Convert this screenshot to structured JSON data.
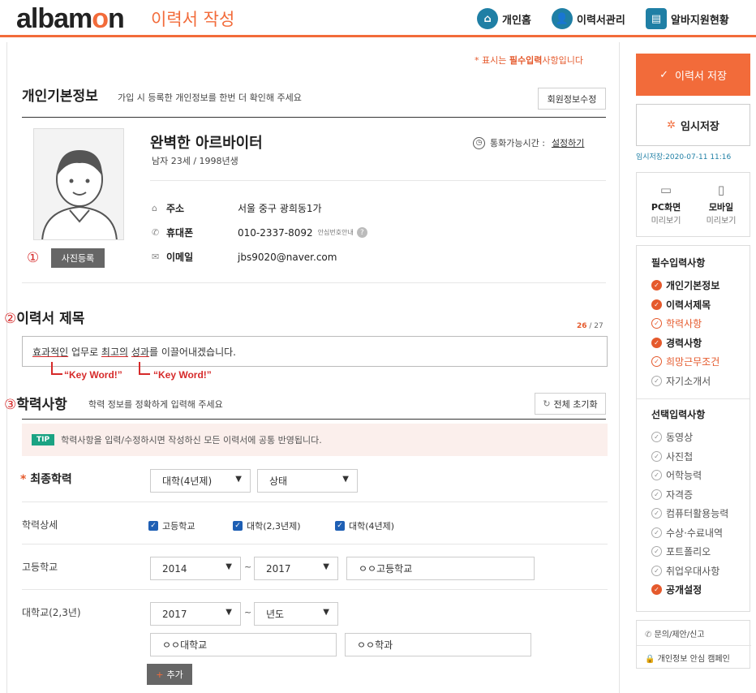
{
  "header": {
    "logo": {
      "a": "albam",
      "o": "o",
      "n": "n"
    },
    "page_title": "이력서 작성",
    "nav": [
      {
        "label": "개인홈",
        "icon": "home-icon"
      },
      {
        "label": "이력서관리",
        "icon": "user-add-icon"
      },
      {
        "label": "알바지원현황",
        "icon": "monitor-icon"
      }
    ]
  },
  "required_note": {
    "star": "*",
    "a": "표시는 ",
    "b": "필수입력",
    "c": "사항입니다"
  },
  "personal": {
    "title": "개인기본정보",
    "subtitle": "가입 시 등록한 개인정보를 한번 더 확인해 주세요",
    "edit_button": "회원정보수정",
    "photo_button": "사진등록",
    "name": "완벽한 아르바이터",
    "meta": "남자 23세 / 1998년생",
    "call_label": "통화가능시간 :",
    "call_link": "설정하기",
    "rows": [
      {
        "label": "주소",
        "value": "서울 중구 광희동1가",
        "extra": ""
      },
      {
        "label": "휴대폰",
        "value": "010-2337-8092",
        "extra": "안심번호안내"
      },
      {
        "label": "이메일",
        "value": "jbs9020@naver.com",
        "extra": ""
      }
    ]
  },
  "annot": {
    "n1": "①",
    "n2": "②",
    "n3": "③",
    "kw1": "“Key Word!”",
    "kw2": "“Key Word!”"
  },
  "resume_title": {
    "title": "이력서 제목",
    "count": "26",
    "max": "/ 27",
    "value": {
      "p1": "효과적인",
      "p2": " 업무로 ",
      "p3": "최고의",
      "p4": " ",
      "p5": "성과",
      "p6": "를 이끌어내겠습니다."
    }
  },
  "education": {
    "title": "학력사항",
    "subtitle": "학력 정보를 정확하게 입력해 주세요",
    "reset_button": "전체 초기화",
    "tip_badge": "TIP",
    "tip_text": "학력사항을 입력/수정하시면 작성하신 모든 이력서에 공통 반영됩니다.",
    "final_label": "최종학력",
    "final_star": "*",
    "final_select": "대학(4년제)",
    "status_select": "상태",
    "detail_label": "학력상세",
    "checks": [
      "고등학교",
      "대학(2,3년제)",
      "대학(4년제)"
    ],
    "hs_label": "고등학교",
    "hs_from": "2014",
    "hs_to": "2017",
    "hs_name": "ㅇㅇ고등학교",
    "col_label": "대학교(2,3년)",
    "col_from": "2017",
    "col_to": "년도",
    "col_name": "ㅇㅇ대학교",
    "col_major": "ㅇㅇ학과",
    "tilde": "~",
    "add_button": "추가"
  },
  "sidebar": {
    "save_button": "이력서 저장",
    "temp_button": "임시저장",
    "temp_time": "임시저장:2020-07-11 11:16",
    "preview": [
      {
        "label": "PC화면",
        "sub": "미리보기"
      },
      {
        "label": "모바일",
        "sub": "미리보기"
      }
    ],
    "required_title": "필수입력사항",
    "required": [
      {
        "label": "개인기본정보",
        "state": "done"
      },
      {
        "label": "이력서제목",
        "state": "done"
      },
      {
        "label": "학력사항",
        "state": "warn"
      },
      {
        "label": "경력사항",
        "state": "done"
      },
      {
        "label": "희망근무조건",
        "state": "warn"
      },
      {
        "label": "자기소개서",
        "state": "todo"
      }
    ],
    "optional_title": "선택입력사항",
    "optional": [
      {
        "label": "동영상",
        "state": "todo"
      },
      {
        "label": "사진첩",
        "state": "todo"
      },
      {
        "label": "어학능력",
        "state": "todo"
      },
      {
        "label": "자격증",
        "state": "todo"
      },
      {
        "label": "컴퓨터활용능력",
        "state": "todo"
      },
      {
        "label": "수상·수료내역",
        "state": "todo"
      },
      {
        "label": "포트폴리오",
        "state": "todo"
      },
      {
        "label": "취업우대사항",
        "state": "todo"
      },
      {
        "label": "공개설정",
        "state": "done"
      }
    ],
    "links": [
      "문의/제안/신고",
      "개인정보 안심 캠페인"
    ]
  },
  "colors": {
    "accent": "#f26b3a",
    "nav_icon": "#1f7fa5",
    "checkbox": "#1e5fb4",
    "annot": "#d62a2a"
  }
}
